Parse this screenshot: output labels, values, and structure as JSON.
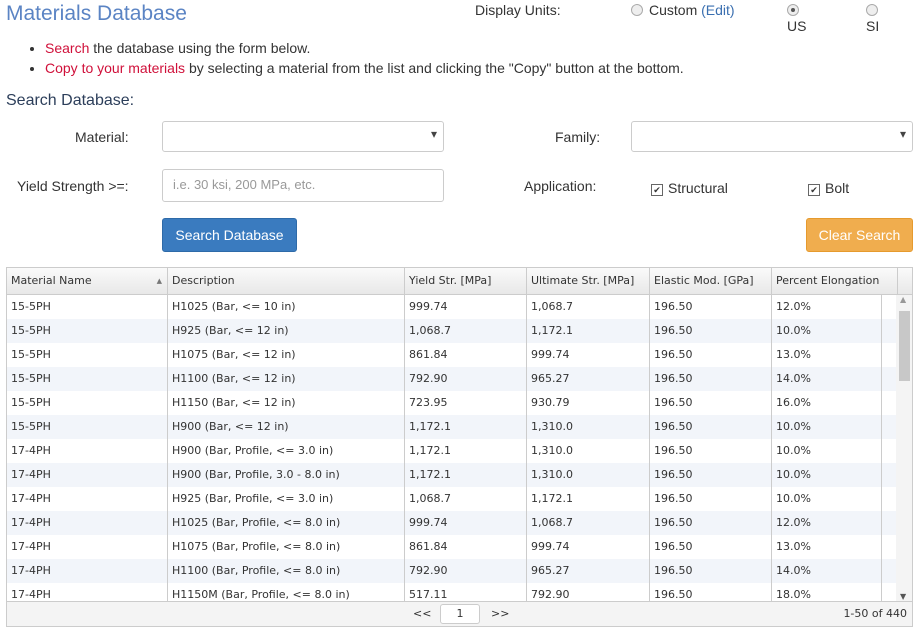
{
  "title": "Materials Database",
  "units": {
    "label": "Display Units:",
    "custom": "Custom",
    "edit": "(Edit)",
    "us": "US",
    "si": "SI",
    "selected": "US"
  },
  "bullets": [
    {
      "highlight": "Search",
      "rest": " the database using the form below."
    },
    {
      "highlight": "Copy to your materials",
      "rest": " by selecting a material from the list and clicking the \"Copy\" button at the bottom."
    }
  ],
  "search": {
    "heading": "Search Database:",
    "material_label": "Material:",
    "family_label": "Family:",
    "yield_label": "Yield Strength >=:",
    "yield_placeholder": "i.e. 30 ksi, 200 MPa, etc.",
    "application_label": "Application:",
    "structural": "Structural",
    "bolt": "Bolt",
    "search_button": "Search Database",
    "clear_button": "Clear Search"
  },
  "table": {
    "columns": [
      "Material Name",
      "Description",
      "Yield Str. [MPa]",
      "Ultimate Str. [MPa]",
      "Elastic Mod. [GPa]",
      "Percent Elongation"
    ],
    "rows": [
      [
        "15-5PH",
        "H1025 (Bar, <= 10 in)",
        "999.74",
        "1,068.7",
        "196.50",
        "12.0%"
      ],
      [
        "15-5PH",
        "H925 (Bar, <= 12 in)",
        "1,068.7",
        "1,172.1",
        "196.50",
        "10.0%"
      ],
      [
        "15-5PH",
        "H1075 (Bar, <= 12 in)",
        "861.84",
        "999.74",
        "196.50",
        "13.0%"
      ],
      [
        "15-5PH",
        "H1100 (Bar, <= 12 in)",
        "792.90",
        "965.27",
        "196.50",
        "14.0%"
      ],
      [
        "15-5PH",
        "H1150 (Bar, <= 12 in)",
        "723.95",
        "930.79",
        "196.50",
        "16.0%"
      ],
      [
        "15-5PH",
        "H900 (Bar, <= 12 in)",
        "1,172.1",
        "1,310.0",
        "196.50",
        "10.0%"
      ],
      [
        "17-4PH",
        "H900 (Bar, Profile, <= 3.0 in)",
        "1,172.1",
        "1,310.0",
        "196.50",
        "10.0%"
      ],
      [
        "17-4PH",
        "H900 (Bar, Profile, 3.0 - 8.0 in)",
        "1,172.1",
        "1,310.0",
        "196.50",
        "10.0%"
      ],
      [
        "17-4PH",
        "H925 (Bar, Profile, <= 3.0 in)",
        "1,068.7",
        "1,172.1",
        "196.50",
        "10.0%"
      ],
      [
        "17-4PH",
        "H1025 (Bar, Profile, <= 8.0 in)",
        "999.74",
        "1,068.7",
        "196.50",
        "12.0%"
      ],
      [
        "17-4PH",
        "H1075 (Bar, Profile, <= 8.0 in)",
        "861.84",
        "999.74",
        "196.50",
        "13.0%"
      ],
      [
        "17-4PH",
        "H1100 (Bar, Profile, <= 8.0 in)",
        "792.90",
        "965.27",
        "196.50",
        "14.0%"
      ],
      [
        "17-4PH",
        "H1150M (Bar, Profile, <= 8.0 in)",
        "517.11",
        "792.90",
        "196.50",
        "18.0%"
      ]
    ],
    "pager": {
      "prev": "<<",
      "page": "1",
      "next": ">>",
      "range": "1-50 of 440"
    }
  },
  "colors": {
    "title": "#5b84c4",
    "highlight": "#d0103a",
    "search_button": "#3a7bbf",
    "clear_button": "#f0ad4e"
  }
}
